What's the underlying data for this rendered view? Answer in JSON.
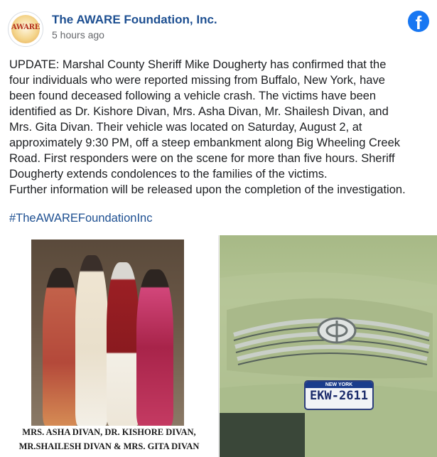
{
  "post": {
    "page_name": "The AWARE Foundation, Inc.",
    "timestamp": "5 hours ago",
    "avatar_text": "AWARE",
    "fb_icon": "f",
    "body": "UPDATE: Marshal County Sheriff Mike Dougherty has confirmed that the\nfour individuals who were reported missing from Buffalo, New York, have\nbeen found deceased following a vehicle crash. The victims have been\nidentified as Dr. Kishore Divan, Mrs. Asha Divan, Mr. Shailesh Divan, and\nMrs. Gita Divan. Their vehicle was located on Saturday, August 2, at\napproximately 9:30 PM, off a steep embankment along Big Wheeling Creek\nRoad. First responders were on the scene for more than five hours. Sheriff\nDougherty extends condolences to the families of the victims.\nFurther information will be released upon the completion of the investigation.",
    "hashtag": "#TheAWAREFoundationInc"
  },
  "photos": {
    "left_caption_line1": "MRS. ASHA DIVAN, DR. KISHORE DIVAN,",
    "left_caption_line2": "MR.SHAILESH DIVAN & MRS. GITA DIVAN",
    "plate_state": "NEW YORK",
    "plate_number": "EKW-2611"
  },
  "colors": {
    "page_name": "#1d4f91",
    "facebook_blue": "#1877f2",
    "car_paint": "#a9bb8a"
  }
}
